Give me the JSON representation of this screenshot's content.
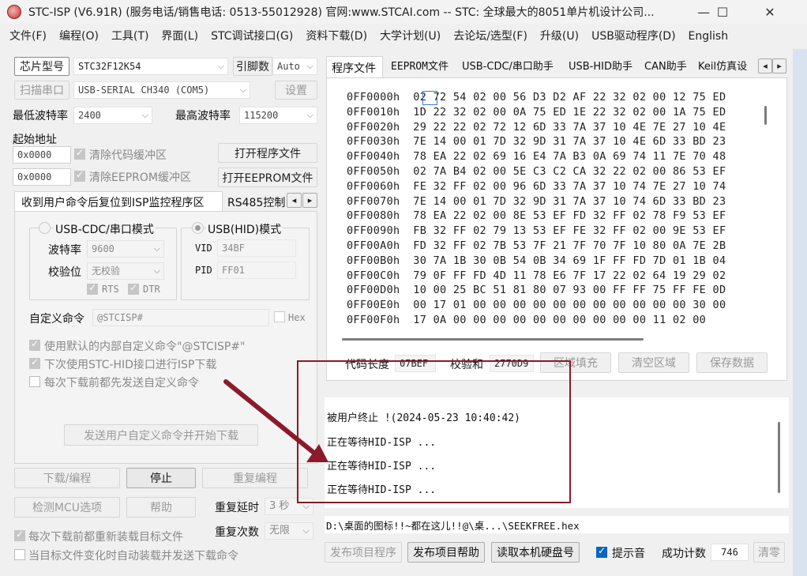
{
  "titlebar": {
    "title": "STC-ISP (V6.91R) (服务电话/销售电话: 0513-55012928) 官网:www.STCAI.com  -- STC: 全球最大的8051单片机设计公司...",
    "minimize": "—",
    "maximize": "☐",
    "close": "✕"
  },
  "menu": [
    "文件(F)",
    "编程(O)",
    "工具(T)",
    "界面(L)",
    "STC调试接口(G)",
    "资料下载(D)",
    "大学计划(U)",
    "去论坛/选型(F)",
    "升级(U)",
    "USB驱动程序(D)",
    "English"
  ],
  "left": {
    "chip_type_button": "芯片型号",
    "chip_type_value": "STC32F12K54",
    "pin_count_button": "引脚数",
    "pin_count_value": "Auto",
    "scan_port_button": "扫描串口",
    "port_value": "USB-SERIAL CH340 (COM5)",
    "settings_button": "设置",
    "min_baud_label": "最低波特率",
    "min_baud_value": "2400",
    "max_baud_label": "最高波特率",
    "max_baud_value": "115200",
    "start_addr_label": "起始地址",
    "code_addr_value": "0x0000",
    "clear_code_label": "清除代码缓冲区",
    "open_program_button": "打开程序文件",
    "eeprom_addr_value": "0x0000",
    "clear_eeprom_label": "清除EEPROM缓冲区",
    "open_eeprom_button": "打开EEPROM文件",
    "tabs": {
      "reset_tab": "收到用户命令后复位到ISP监控程序区",
      "rs485_tab": "RS485控制",
      "prev": "◂",
      "next": "▸"
    },
    "usb_cdc_mode": "USB-CDC/串口模式",
    "baud_label": "波特率",
    "baud_value": "9600",
    "parity_label": "校验位",
    "parity_value": "无校验",
    "rts_label": "RTS",
    "dtr_label": "DTR",
    "usb_hid_mode": "USB(HID)模式",
    "vid_label": "VID",
    "vid_value": "34BF",
    "pid_label": "PID",
    "pid_value": "FF01",
    "custom_cmd_label": "自定义命令",
    "custom_cmd_value": "@STCISP#",
    "hex_label": "Hex",
    "opt_default_cmd": "使用默认的内部自定义命令\"@STCISP#\"",
    "opt_next_hid": "下次使用STC-HID接口进行ISP下载",
    "opt_send_before": "每次下载前都先发送自定义命令",
    "send_and_download_button": "发送用户自定义命令并开始下载",
    "download_button": "下载/编程",
    "stop_button": "停止",
    "reprogram_button": "重复编程",
    "check_mcu_button": "检测MCU选项",
    "help_button": "帮助",
    "repeat_delay_label": "重复延时",
    "repeat_delay_value": "3 秒",
    "repeat_count_label": "重复次数",
    "repeat_count_value": "无限",
    "reload_label": "每次下载前都重新装载目标文件",
    "auto_send_label": "当目标文件变化时自动装载并发送下载命令"
  },
  "right": {
    "tabs": [
      "程序文件",
      "EEPROM文件",
      "USB-CDC/串口助手",
      "USB-HID助手",
      "CAN助手",
      "Keil仿真设"
    ],
    "tab_prev": "◂",
    "tab_next": "▸",
    "hex_rows": [
      {
        "addr": "0FF0000h",
        "bytes": "02 72 54 02 00 56 D3 D2 AF 22 32 02 00 12 75 ED"
      },
      {
        "addr": "0FF0010h",
        "bytes": "1D 22 32 02 00 0A 75 ED 1E 22 32 02 00 1A 75 ED"
      },
      {
        "addr": "0FF0020h",
        "bytes": "29 22 22 02 72 12 6D 33 7A 37 10 4E 7E 27 10 4E"
      },
      {
        "addr": "0FF0030h",
        "bytes": "7E 14 00 01 7D 32 9D 31 7A 37 10 4E 6D 33 BD 23"
      },
      {
        "addr": "0FF0040h",
        "bytes": "78 EA 22 02 69 16 E4 7A B3 0A 69 74 11 7E 70 48"
      },
      {
        "addr": "0FF0050h",
        "bytes": "02 7A B4 02 00 5E C3 C2 CA 32 22 02 00 86 53 EF"
      },
      {
        "addr": "0FF0060h",
        "bytes": "FE 32 FF 02 00 96 6D 33 7A 37 10 74 7E 27 10 74"
      },
      {
        "addr": "0FF0070h",
        "bytes": "7E 14 00 01 7D 32 9D 31 7A 37 10 74 6D 33 BD 23"
      },
      {
        "addr": "0FF0080h",
        "bytes": "78 EA 22 02 00 8E 53 EF FD 32 FF 02 78 F9 53 EF"
      },
      {
        "addr": "0FF0090h",
        "bytes": "FB 32 FF 02 79 13 53 EF FE 32 FF 02 00 9E 53 EF"
      },
      {
        "addr": "0FF00A0h",
        "bytes": "FD 32 FF 02 7B 53 7F 21 7F 70 7F 10 80 0A 7E 2B"
      },
      {
        "addr": "0FF00B0h",
        "bytes": "30 7A 1B 30 0B 54 0B 34 69 1F FF FD 7D 01 1B 04"
      },
      {
        "addr": "0FF00C0h",
        "bytes": "79 0F FF FD 4D 11 78 E6 7F 17 22 02 64 19 29 02"
      },
      {
        "addr": "0FF00D0h",
        "bytes": "10 00 25 BC 51 81 80 07 93 00 FF FF 75 FF FE 0D"
      },
      {
        "addr": "0FF00E0h",
        "bytes": "00 17 01 00 00 00 00 00 00 00 00 00 00 00 30 00"
      },
      {
        "addr": "0FF00F0h",
        "bytes": "17 0A 00 00 00 00 00 00 00 00 00 00 11 02 00"
      }
    ],
    "code_len_label": "代码长度",
    "code_len_value": "07BEF",
    "checksum_label": "校验和",
    "checksum_value": "2770D9",
    "fill_button": "区域填充",
    "clear_button": "清空区域",
    "save_button": "保存数据",
    "log_lines": [
      "被用户终止 !(2024-05-23 10:40:42)",
      "正在等待HID-ISP ...",
      "正在等待HID-ISP ...",
      "正在等待HID-ISP ..."
    ],
    "file_path": "D:\\桌面的图标!!~都在这儿!!@\\桌...\\SEEKFREE.hex",
    "publish_program_button": "发布项目程序",
    "publish_help_button": "发布项目帮助",
    "read_disk_button": "读取本机硬盘号",
    "beep_label": "提示音",
    "success_count_label": "成功计数",
    "success_count_value": "746",
    "clear_count_button": "清零"
  },
  "colors": {
    "annotation": "#8b1a2b",
    "accent": "#0b64c2"
  }
}
